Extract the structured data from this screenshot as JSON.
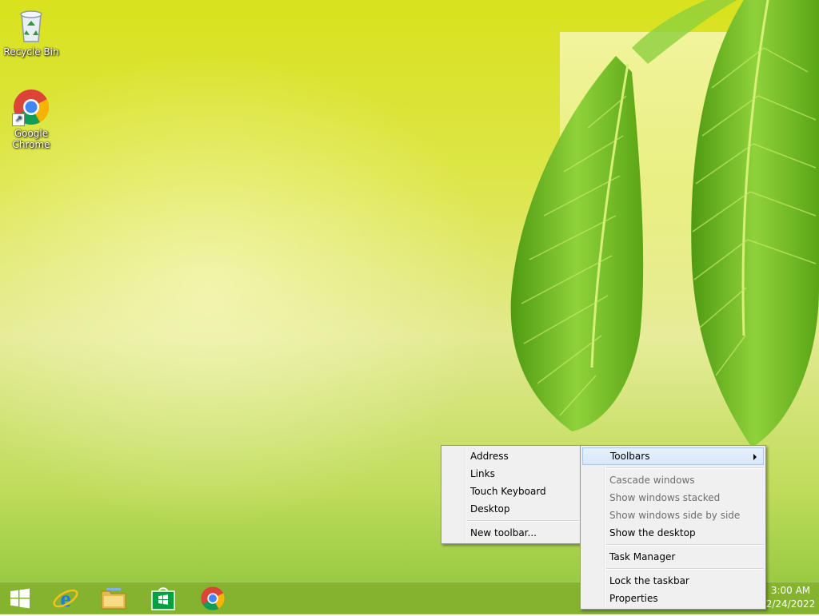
{
  "desktop": {
    "icons": [
      {
        "label_line1": "Recycle Bin",
        "label_line2": "",
        "icon": "recycle-bin-icon"
      },
      {
        "label_line1": "Google",
        "label_line2": "Chrome",
        "icon": "chrome-icon"
      }
    ]
  },
  "taskbar": {
    "buttons": [
      {
        "name": "Start",
        "icon": "windows-logo-icon"
      },
      {
        "name": "Internet Explorer",
        "icon": "internet-explorer-icon"
      },
      {
        "name": "File Explorer",
        "icon": "file-explorer-icon"
      },
      {
        "name": "Store",
        "icon": "store-icon"
      },
      {
        "name": "Google Chrome",
        "icon": "chrome-icon"
      }
    ],
    "clock": {
      "time": "3:00 AM",
      "date": "2/24/2022"
    }
  },
  "context_menu": {
    "items": [
      {
        "label": "Toolbars",
        "state": "highlighted",
        "submenu": true
      },
      {
        "label": "Cascade windows",
        "state": "disabled"
      },
      {
        "label": "Show windows stacked",
        "state": "disabled"
      },
      {
        "label": "Show windows side by side",
        "state": "disabled"
      },
      {
        "label": "Show the desktop",
        "state": "enabled"
      },
      {
        "label": "Task Manager",
        "state": "enabled"
      },
      {
        "label": "Lock the taskbar",
        "state": "enabled"
      },
      {
        "label": "Properties",
        "state": "enabled"
      }
    ]
  },
  "toolbars_submenu": {
    "items": [
      {
        "label": "Address"
      },
      {
        "label": "Links"
      },
      {
        "label": "Touch Keyboard"
      },
      {
        "label": "Desktop"
      },
      {
        "label": "New toolbar..."
      }
    ]
  },
  "colors": {
    "taskbar": "#82af2d",
    "menu_bg": "#f0f0f0",
    "highlight": "#d7e8fb"
  }
}
